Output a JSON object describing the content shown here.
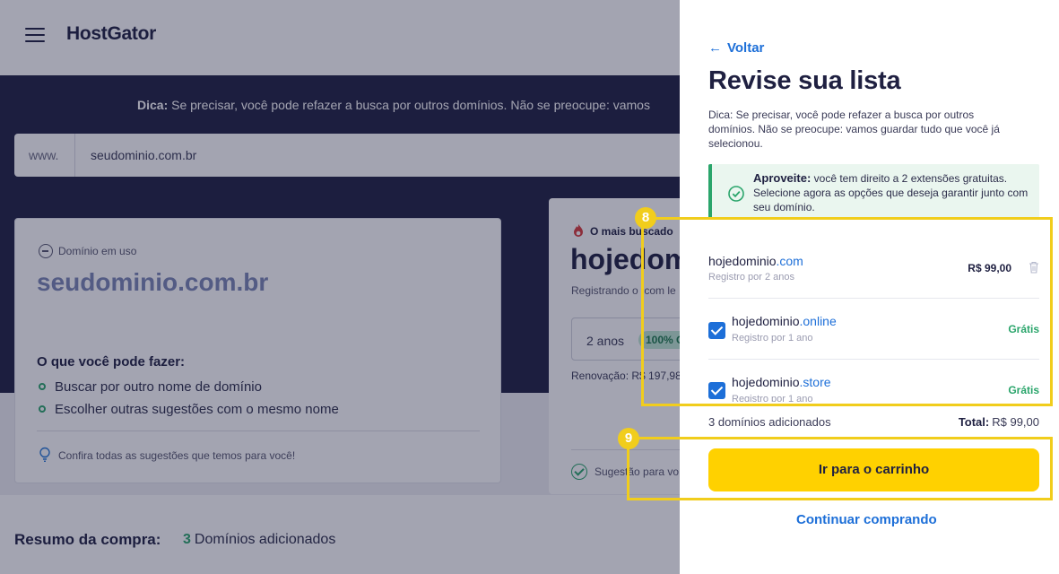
{
  "header": {
    "logo_text": "HostGator"
  },
  "banner": {
    "tip_label": "Dica:",
    "tip_text": "Se precisar, você pode refazer a busca por outros domínios. Não se preocupe: vamos"
  },
  "search": {
    "prefix": "www.",
    "value": "seudominio.com.br"
  },
  "domain_in_use_card": {
    "label": "Domínio em uso",
    "domain": "seudominio.com.br",
    "heading": "O que você pode fazer:",
    "options": [
      "Buscar por outro nome de domínio",
      "Escolher outras sugestões com o mesmo nome"
    ],
    "hint": "Confira todas as sugestões que temos para você!"
  },
  "suggestion_card": {
    "badge": "O mais buscado",
    "domain_partial": "hojedom",
    "registering": "Registrando o .com le",
    "period": "2 anos",
    "discount": "100% O",
    "renewal": "Renovação: R$ 197,98",
    "footer": "Sugestão para vo"
  },
  "summary": {
    "title": "Resumo da compra:",
    "count": "3",
    "count_label": "Domínios adicionados"
  },
  "drawer": {
    "back_label": "Voltar",
    "title": "Revise sua lista",
    "tip": "Dica: Se precisar, você pode refazer a busca por outros domínios. Não se preocupe: vamos guardar tudo que você já selecionou.",
    "alert_title": "Aproveite:",
    "alert_text": "você tem direito a 2 extensões gratuitas. Selecione agora as opções que deseja garantir junto com seu domínio.",
    "items": [
      {
        "name": "hojedominio",
        "ext": ".com",
        "period": "Registro por 2 anos",
        "price": "R$ 99,00"
      },
      {
        "name": "hojedominio",
        "ext": ".online",
        "period": "Registro por 1 ano",
        "price": "Grátis",
        "checked": true
      },
      {
        "name": "hojedominio",
        "ext": ".store",
        "period": "Registro por 1 ano",
        "price": "Grátis",
        "checked": true
      }
    ],
    "added_count": "3 domínios adicionados",
    "total_label": "Total:",
    "total_value": "R$ 99,00",
    "cart_button": "Ir para o carrinho",
    "continue_link": "Continuar comprando"
  },
  "annotations": {
    "step_8": "8",
    "step_9": "9",
    "color": "#f1cd1c"
  },
  "colors": {
    "brand_dark": "#1f2041",
    "link_blue": "#1d6fd8",
    "cta_yellow": "#ffd100",
    "success_green": "#2aa56b"
  }
}
